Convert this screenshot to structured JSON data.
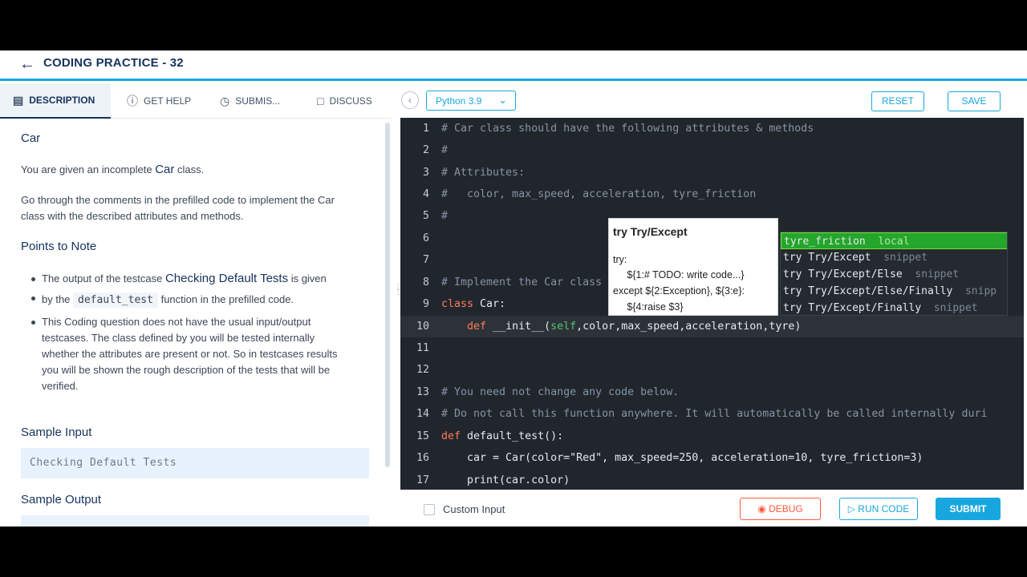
{
  "header": {
    "back_icon": "arrow-left-icon",
    "title": "CODING PRACTICE - 32"
  },
  "tabs": [
    {
      "label": "DESCRIPTION",
      "icon": "description-icon",
      "active": true
    },
    {
      "label": "GET HELP",
      "icon": "help-icon",
      "active": false
    },
    {
      "label": "SUBMIS...",
      "icon": "clock-icon",
      "active": false
    },
    {
      "label": "DISCUSS",
      "icon": "chat-icon",
      "active": false
    }
  ],
  "toolbar": {
    "language": "Python 3.9",
    "reset_label": "RESET",
    "save_label": "SAVE"
  },
  "description": {
    "title": "Car",
    "intro_pre": "You are given an incomplete ",
    "intro_class": "Car",
    "intro_post": " class.",
    "para_line1": "Go through the comments in the prefilled code to implement the Car",
    "para_line2": "class with the described attributes and methods.",
    "points_heading": "Points to Note",
    "bullet1_pre": "The output of the testcase ",
    "bullet1_strong": "Checking Default Tests",
    "bullet1_mid": " is given",
    "bullet1_by": "by the ",
    "bullet1_code": "default_test",
    "bullet1_post": " function in the prefilled code.",
    "bullet2_lines": [
      "This Coding question does not have the usual input/output",
      "testcases. The class defined by you will be tested internally",
      "whether the attributes are present or not. So in testcases results",
      "you will be shown the rough description of the tests that will be",
      "verified."
    ],
    "sample_input_heading": "Sample Input",
    "sample_input": "Checking Default Tests",
    "sample_output_heading": "Sample Output"
  },
  "editor": {
    "line_numbers": [
      "1",
      "2",
      "3",
      "4",
      "5",
      "6",
      "7",
      "8",
      "9",
      "10",
      "11",
      "12",
      "13",
      "14",
      "15",
      "16",
      "17"
    ],
    "current_line": 10
  },
  "tooltip": {
    "title": "try Try/Except",
    "lines": [
      "try:",
      "     ${1:# TODO: write code...}",
      "except ${2:Exception}, ${3:e}:",
      "     ${4:raise $3}"
    ]
  },
  "suggestions": [
    {
      "prefix": "tyre_friction",
      "kind": "local",
      "selected": true
    },
    {
      "prefix": "try Try/Except",
      "kind": "snippet",
      "selected": false
    },
    {
      "prefix": "try Try/Except/Else",
      "kind": "snippet",
      "selected": false
    },
    {
      "prefix": "try Try/Except/Else/Finally",
      "kind": "snipp",
      "selected": false
    },
    {
      "prefix": "try Try/Except/Finally",
      "kind": "snippet",
      "selected": false
    }
  ],
  "footer": {
    "custom_input_label": "Custom Input",
    "debug_label": "DEBUG",
    "run_label": "RUN CODE",
    "submit_label": "SUBMIT"
  },
  "colors": {
    "accent": "#17a7de",
    "navy": "#16325c",
    "debug": "#ff5a3c",
    "editor_bg": "#21262d",
    "suggest_selected": "#24a52b"
  }
}
